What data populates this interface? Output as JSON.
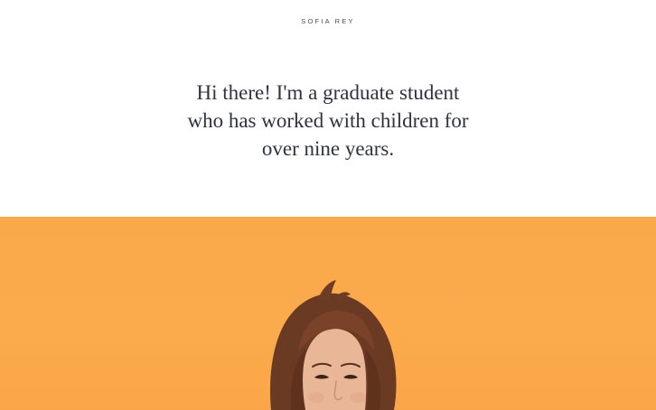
{
  "header": {
    "site_name": "SOFIA REY"
  },
  "intro": {
    "lines": [
      "Hi there! I'm a graduate student",
      "who has worked with children for",
      "over nine years."
    ]
  },
  "hero": {
    "background_color": "#fbab4c",
    "image_label": "Smiling woman with brown hair against orange background"
  }
}
